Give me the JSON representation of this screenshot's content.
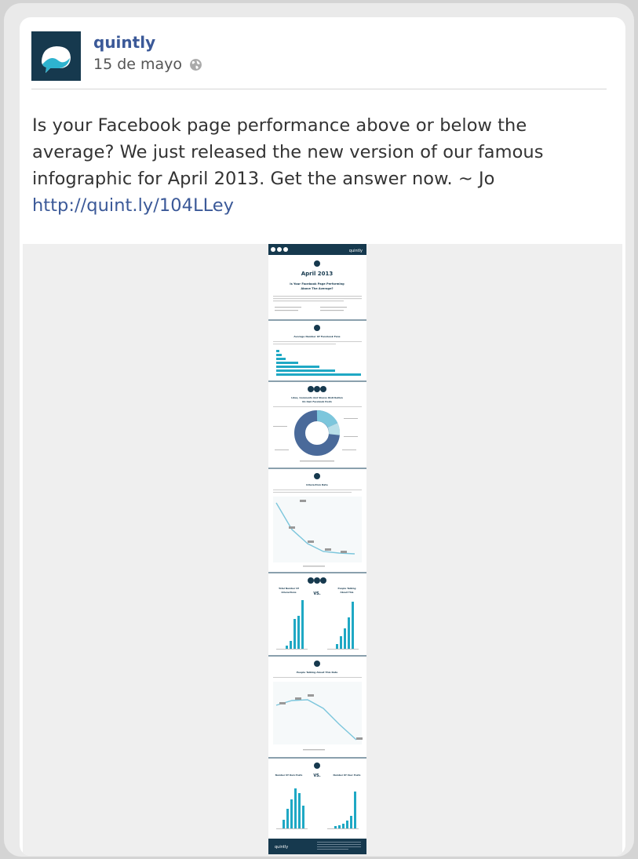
{
  "post": {
    "author": "quintly",
    "date": "15 de mayo",
    "text_lines": [
      "Is your Facebook page performance above or below the",
      "average? We just released the new version of our famous",
      "infographic for April 2013. Get the answer now. ~ Jo"
    ],
    "link": "http://quint.ly/104LLey"
  },
  "infographic": {
    "brand": "quintly",
    "month_title": "April 2013",
    "headline_1": "Is Your Facebook Page Performing",
    "headline_2": "Above The Average?",
    "section_fans": "Average Number Of Facebook Fans",
    "section_likes_1": "Likes, Comments And Shares Distribution",
    "section_likes_2": "On Own Facebook Posts",
    "section_interaction": "Interaction Rate",
    "total_interactions_1": "Total Number Of",
    "total_interactions_2": "Interactions",
    "vs_1": "VS.",
    "ptat_1": "People Talking",
    "ptat_2": "About This",
    "section_ptat_rate": "People Talking About This Rate",
    "own_posts": "Number Of Own Posts",
    "vs_2": "VS.",
    "user_posts": "Number Of User Posts",
    "footer_brand": "quintly"
  },
  "colors": {
    "brand_dark": "#16394e",
    "accent_teal": "#1fa8c4",
    "link_blue": "#3b5998",
    "donut_dark": "#4a6a9a"
  }
}
